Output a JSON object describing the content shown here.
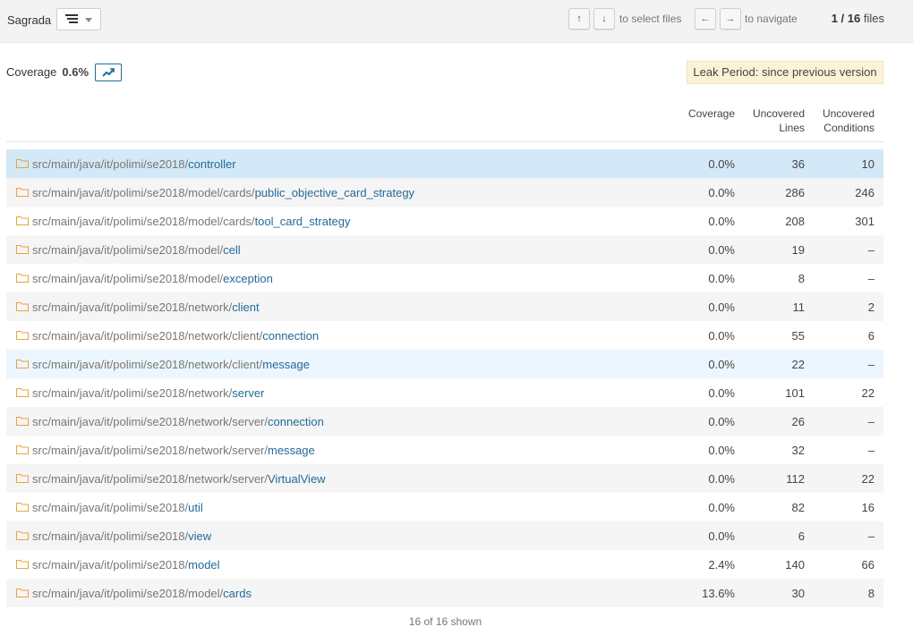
{
  "header": {
    "project": "Sagrada",
    "select_hint": "to select files",
    "navigate_hint": "to navigate",
    "keys": {
      "up": "↑",
      "down": "↓",
      "left": "←",
      "right": "→"
    },
    "files_current": "1",
    "files_total": "16",
    "files_suffix": "files"
  },
  "summary": {
    "label": "Coverage",
    "value": "0.6%",
    "chart_icon": "trend-chart-icon"
  },
  "leak_period": "Leak Period: since previous version",
  "columns": {
    "coverage": "Coverage",
    "uncovered_lines_1": "Uncovered",
    "uncovered_lines_2": "Lines",
    "uncovered_conditions_1": "Uncovered",
    "uncovered_conditions_2": "Conditions"
  },
  "rows": [
    {
      "dir": "src/main/java/it/polimi/se2018/",
      "name": "controller",
      "coverage": "0.0%",
      "lines": "36",
      "conditions": "10"
    },
    {
      "dir": "src/main/java/it/polimi/se2018/model/cards/",
      "name": "public_objective_card_strategy",
      "coverage": "0.0%",
      "lines": "286",
      "conditions": "246"
    },
    {
      "dir": "src/main/java/it/polimi/se2018/model/cards/",
      "name": "tool_card_strategy",
      "coverage": "0.0%",
      "lines": "208",
      "conditions": "301"
    },
    {
      "dir": "src/main/java/it/polimi/se2018/model/",
      "name": "cell",
      "coverage": "0.0%",
      "lines": "19",
      "conditions": "–"
    },
    {
      "dir": "src/main/java/it/polimi/se2018/model/",
      "name": "exception",
      "coverage": "0.0%",
      "lines": "8",
      "conditions": "–"
    },
    {
      "dir": "src/main/java/it/polimi/se2018/network/",
      "name": "client",
      "coverage": "0.0%",
      "lines": "11",
      "conditions": "2"
    },
    {
      "dir": "src/main/java/it/polimi/se2018/network/client/",
      "name": "connection",
      "coverage": "0.0%",
      "lines": "55",
      "conditions": "6"
    },
    {
      "dir": "src/main/java/it/polimi/se2018/network/client/",
      "name": "message",
      "coverage": "0.0%",
      "lines": "22",
      "conditions": "–"
    },
    {
      "dir": "src/main/java/it/polimi/se2018/network/",
      "name": "server",
      "coverage": "0.0%",
      "lines": "101",
      "conditions": "22"
    },
    {
      "dir": "src/main/java/it/polimi/se2018/network/server/",
      "name": "connection",
      "coverage": "0.0%",
      "lines": "26",
      "conditions": "–"
    },
    {
      "dir": "src/main/java/it/polimi/se2018/network/server/",
      "name": "message",
      "coverage": "0.0%",
      "lines": "32",
      "conditions": "–"
    },
    {
      "dir": "src/main/java/it/polimi/se2018/network/server/",
      "name": "VirtualView",
      "coverage": "0.0%",
      "lines": "112",
      "conditions": "22"
    },
    {
      "dir": "src/main/java/it/polimi/se2018/",
      "name": "util",
      "coverage": "0.0%",
      "lines": "82",
      "conditions": "16"
    },
    {
      "dir": "src/main/java/it/polimi/se2018/",
      "name": "view",
      "coverage": "0.0%",
      "lines": "6",
      "conditions": "–"
    },
    {
      "dir": "src/main/java/it/polimi/se2018/",
      "name": "model",
      "coverage": "2.4%",
      "lines": "140",
      "conditions": "66"
    },
    {
      "dir": "src/main/java/it/polimi/se2018/model/",
      "name": "cards",
      "coverage": "13.6%",
      "lines": "30",
      "conditions": "8"
    }
  ],
  "shown": "16 of 16 shown",
  "colors": {
    "link": "#236a97",
    "selected_row": "#d4e9f7",
    "hover_row": "#ecf6fe",
    "leak_bg": "#fbf3d5",
    "folder": "#e8a33a"
  }
}
